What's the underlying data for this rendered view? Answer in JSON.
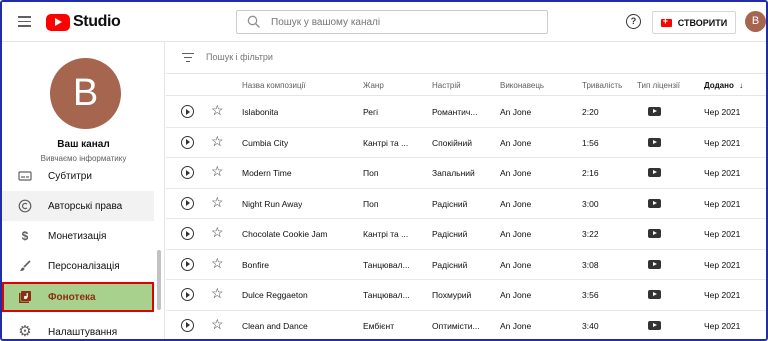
{
  "header": {
    "app_name": "Studio",
    "search_placeholder": "Пошук у вашому каналі",
    "create_label": "СТВОРИТИ",
    "account_initial": "B"
  },
  "sidebar": {
    "channel_initial": "B",
    "channel_name": "Ваш канал",
    "channel_subtitle": "Вивчаємо інформатику",
    "items": [
      {
        "label": "Субтитри",
        "icon": "subtitles-icon"
      },
      {
        "label": "Авторські права",
        "icon": "copyright-icon"
      },
      {
        "label": "Монетизація",
        "icon": "dollar-icon"
      },
      {
        "label": "Персоналізація",
        "icon": "brush-icon"
      },
      {
        "label": "Фонотека",
        "icon": "audio-library-icon"
      },
      {
        "label": "Налаштування",
        "icon": "gear-icon"
      }
    ],
    "active_index": 4
  },
  "main": {
    "filter_placeholder": "Пошук і фільтри",
    "columns": {
      "title": "Назва композиції",
      "genre": "Жанр",
      "mood": "Настрій",
      "artist": "Виконавець",
      "duration": "Тривалість",
      "license": "Тип ліцензії",
      "added": "Додано",
      "sort_arrow": "↓"
    },
    "rows": [
      {
        "title": "Islabonita",
        "genre": "Регі",
        "mood": "Романтич...",
        "artist": "An Jone",
        "duration": "2:20",
        "added": "Чер 2021"
      },
      {
        "title": "Cumbia City",
        "genre": "Кантрі та ...",
        "mood": "Спокійний",
        "artist": "An Jone",
        "duration": "1:56",
        "added": "Чер 2021"
      },
      {
        "title": "Modern Time",
        "genre": "Поп",
        "mood": "Запальний",
        "artist": "An Jone",
        "duration": "2:16",
        "added": "Чер 2021"
      },
      {
        "title": "Night Run Away",
        "genre": "Поп",
        "mood": "Радісний",
        "artist": "An Jone",
        "duration": "3:00",
        "added": "Чер 2021"
      },
      {
        "title": "Chocolate Cookie Jam",
        "genre": "Кантрі та ...",
        "mood": "Радісний",
        "artist": "An Jone",
        "duration": "3:22",
        "added": "Чер 2021"
      },
      {
        "title": "Bonfire",
        "genre": "Танцювал...",
        "mood": "Радісний",
        "artist": "An Jone",
        "duration": "3:08",
        "added": "Чер 2021"
      },
      {
        "title": "Dulce Reggaeton",
        "genre": "Танцювал...",
        "mood": "Похмурий",
        "artist": "An Jone",
        "duration": "3:56",
        "added": "Чер 2021"
      },
      {
        "title": "Clean and Dance",
        "genre": "Ембієнт",
        "mood": "Оптимісти...",
        "artist": "An Jone",
        "duration": "3:40",
        "added": "Чер 2021"
      }
    ]
  },
  "colors": {
    "brand_red": "#ff0000",
    "avatar": "#a5654f",
    "active_nav_bg": "#a9d18e",
    "active_nav_border": "#e00000"
  }
}
